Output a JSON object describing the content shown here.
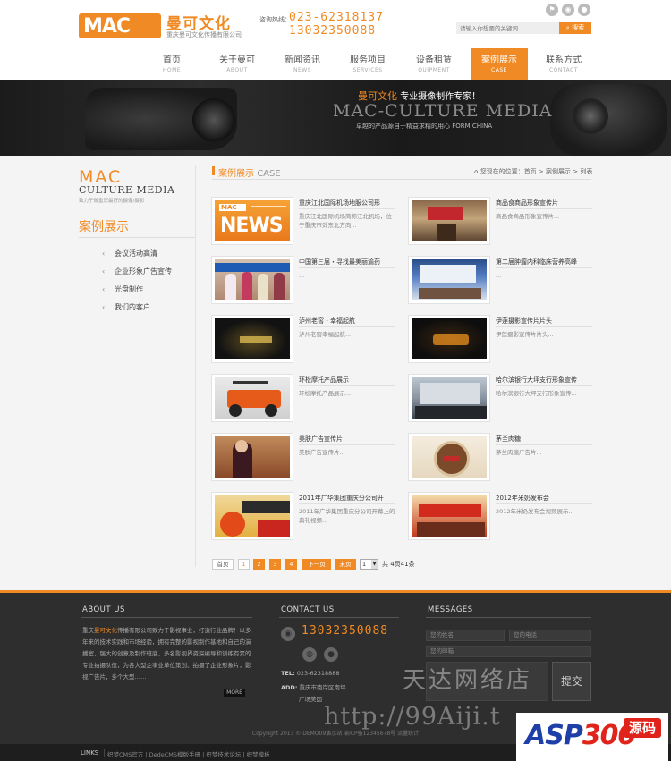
{
  "header": {
    "logo_mark": "MAC",
    "logo_cn": "曼可文化",
    "logo_sub": "重庆曼可文化传播有限公司",
    "hotline_label": "咨询热线：",
    "hotline_1": "023-62318137",
    "hotline_2": "13032350088",
    "search_placeholder": "请输入你想要的关键词",
    "search_button": "搜索"
  },
  "nav": [
    {
      "cn": "首页",
      "en": "HOME"
    },
    {
      "cn": "关于曼可",
      "en": "ABOUT"
    },
    {
      "cn": "新闻资讯",
      "en": "NEWS"
    },
    {
      "cn": "服务项目",
      "en": "SERVICES"
    },
    {
      "cn": "设备租赁",
      "en": "QUIPMENT"
    },
    {
      "cn": "案例展示",
      "en": "CASE"
    },
    {
      "cn": "联系方式",
      "en": "CONTACT"
    }
  ],
  "banner": {
    "slogan_hl": "曼可文化",
    "slogan": "专业摄像制作专家！",
    "big": "MAC-CULTURE MEDIA",
    "sub": "卓越的产品源自于精益求精的用心  FORM CHINA"
  },
  "sidebar": {
    "logo_mac": "MAC",
    "logo_cm": "CULTURE MEDIA",
    "logo_sub": "致力于做重庆最好的摄像/摄影",
    "title": "案例展示",
    "items": [
      "会议活动高清",
      "企业形象广告宣传",
      "光盘制作",
      "我们的客户"
    ]
  },
  "main": {
    "title_cn": "案例展示",
    "title_en": "CASE",
    "crumb_label": "您现在的位置：",
    "crumbs": [
      "首页",
      "案例展示",
      "列表"
    ],
    "cases": [
      {
        "title": "重庆江北国际机场地服公司形",
        "desc": "重庆江北国际机场简称江北机场，位于重庆市郊东北方向..."
      },
      {
        "title": "商品食商品形象宣传片",
        "desc": "商品食商品形象宣传片..."
      },
      {
        "title": "中国第三届・寻找最美丽渝药",
        "desc": "..."
      },
      {
        "title": "第二届肿瘤内科临床营养高峰",
        "desc": "..."
      },
      {
        "title": "泸州老窖・幸福起航",
        "desc": "泸州老窖幸福起航..."
      },
      {
        "title": "伊莲摄影宣传片片头",
        "desc": "伊莲摄影宣传片片头..."
      },
      {
        "title": "环松摩托产品展示",
        "desc": "环松摩托产品展示..."
      },
      {
        "title": "哈尔滨银行大坪支行形象宣传",
        "desc": "哈尔滨银行大坪支行形象宣传..."
      },
      {
        "title": "美肤广告宣传片",
        "desc": "美肤广告宣传片..."
      },
      {
        "title": "茅兰肉糖",
        "desc": "茅兰肉糖广告片..."
      },
      {
        "title": "2011年广华集团重庆分公司开",
        "desc": "2011年广华集团重庆分公司开幕上的典礼视频..."
      },
      {
        "title": "2012年米奶发布会",
        "desc": "2012年米奶发布会视频展示..."
      }
    ],
    "pager": {
      "first": "首页",
      "pages": [
        "1",
        "2",
        "3",
        "4"
      ],
      "next": "下一页",
      "last": "末页",
      "select_value": "1",
      "total": "共 4页41条"
    }
  },
  "footer": {
    "about_title": "ABOUT US",
    "about_hl": "曼可文化",
    "about_pre": "重庆",
    "about_text": "传播有限公司致力于影视事业，打造行业品牌！以多年来的技术实践和市场经验，拥有完整的影视制作基地和自己的演播室，强大的创意及制作班底，多名影视界资深编导和训练有素的专业拍摄队伍，为各大型企事业单位策划、拍摄了企业形象片，影视广告片，多个大型……",
    "more": "MORE",
    "contact_title": "CONTACT US",
    "phone": "13032350088",
    "tel_label": "TEL:",
    "tel": "023-62318888",
    "addr_label": "ADD:",
    "addr_1": "重庆市南岸区南坪",
    "addr_2": "广场美国",
    "messages_title": "MESSAGES",
    "msg_name": "您的姓名",
    "msg_phone": "您的电话",
    "msg_email": "您的邮箱",
    "submit": "提交",
    "copyright": "Copyright 2013 © DEMO09演示站   渝ICP备12345678号   流量统计",
    "links_label": "LINKS",
    "links_text": "织梦CMS官方 | DedeCMS模版手册 | 织梦技术论坛 | 织梦模板"
  },
  "watermark": {
    "cn": "天达网络店",
    "url": "http://99Aiji.t",
    "asp": "ASP",
    "asp_num": "300",
    "asp_ym": "源码"
  },
  "colors": {
    "accent": "#f08a24",
    "footer_bg": "#2e2e2e",
    "content_bg": "#f4f4f4"
  }
}
